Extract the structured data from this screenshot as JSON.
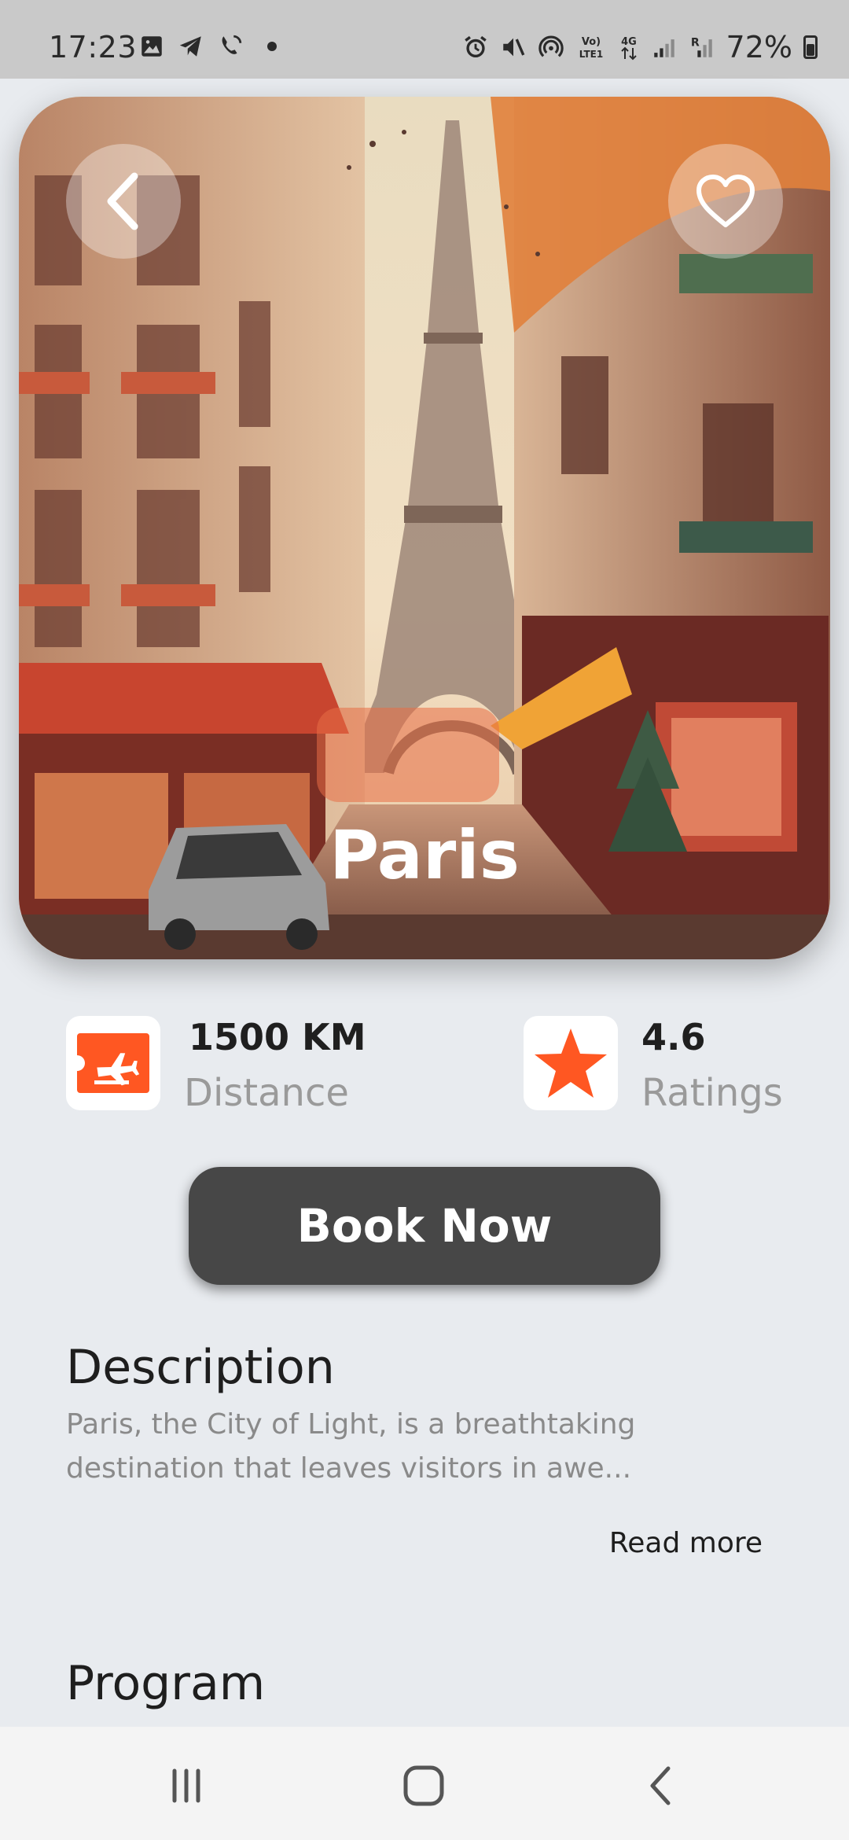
{
  "status_bar": {
    "time": "17:23",
    "battery": "72%",
    "left_icons": [
      "gallery-icon",
      "telegram-icon",
      "wifi-call-icon"
    ],
    "right_icons": [
      "alarm-icon",
      "mute-icon",
      "hotspot-icon",
      "volte-icon",
      "4g-icon",
      "signal-icon",
      "signal-roaming-icon",
      "battery-icon"
    ],
    "network_labels": {
      "volte": "Vo) LTE1",
      "data": "4G"
    }
  },
  "hero": {
    "city": "Paris",
    "back_icon": "chevron-left-icon",
    "favorite_icon": "heart-outline-icon"
  },
  "stats": {
    "distance": {
      "value": "1500 KM",
      "label": "Distance",
      "icon": "flight-ticket-icon"
    },
    "ratings": {
      "value": "4.6",
      "label": "Ratings",
      "icon": "star-icon"
    }
  },
  "book_button": {
    "label": "Book Now"
  },
  "description": {
    "title": "Description",
    "lines": [
      "Paris, the City of Light, is a breathtaking",
      "destination that leaves visitors in awe..."
    ],
    "read_more": "Read more"
  },
  "program": {
    "title": "Program"
  },
  "nav_bar": {
    "recent_icon": "recent-apps-icon",
    "home_icon": "home-icon",
    "back_icon": "back-icon"
  },
  "colors": {
    "accent": "#FF5722",
    "button": "#474747",
    "background": "#E8EBEF"
  }
}
